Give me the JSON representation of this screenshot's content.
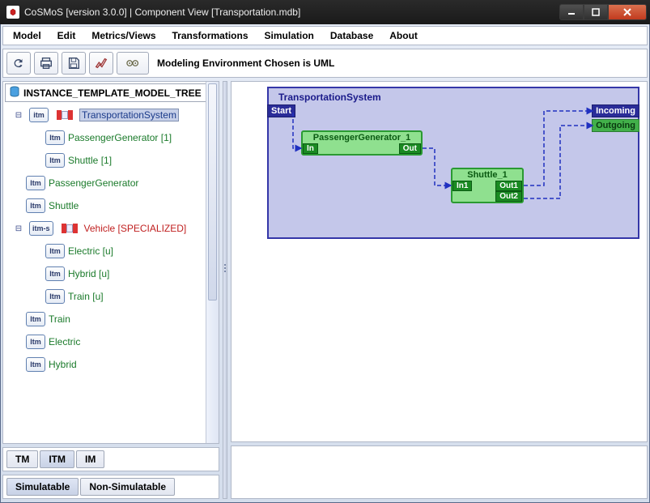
{
  "window": {
    "title": "CoSMoS [version 3.0.0] | Component View [Transportation.mdb]"
  },
  "menu": {
    "items": [
      "Model",
      "Edit",
      "Metrics/Views",
      "Transformations",
      "Simulation",
      "Database",
      "About"
    ]
  },
  "toolbar": {
    "icons": [
      "refresh-icon",
      "print-icon",
      "save-icon",
      "chart-icon",
      "gears-icon"
    ],
    "status": "Modeling Environment Chosen is UML"
  },
  "tree": {
    "header": "INSTANCE_TEMPLATE_MODEL_TREE",
    "nodes": [
      {
        "indent": 0,
        "toggle": "▾",
        "icon": "comp",
        "label": "TransportationSystem",
        "selected": true
      },
      {
        "indent": 1,
        "toggle": "",
        "icon": "Itm",
        "label": "PassengerGenerator [1]"
      },
      {
        "indent": 1,
        "toggle": "",
        "icon": "Itm",
        "label": "Shuttle [1]"
      },
      {
        "indent": 0,
        "toggle": "",
        "icon": "Itm",
        "label": "PassengerGenerator"
      },
      {
        "indent": 0,
        "toggle": "",
        "icon": "Itm",
        "label": "Shuttle"
      },
      {
        "indent": 0,
        "toggle": "▾",
        "icon": "comp",
        "iconText": "itm-s",
        "label": "Vehicle [SPECIALIZED]",
        "red": true
      },
      {
        "indent": 1,
        "toggle": "",
        "icon": "Itm",
        "label": "Electric [u]"
      },
      {
        "indent": 1,
        "toggle": "",
        "icon": "Itm",
        "label": "Hybrid [u]"
      },
      {
        "indent": 1,
        "toggle": "",
        "icon": "Itm",
        "label": "Train [u]"
      },
      {
        "indent": 0,
        "toggle": "",
        "icon": "Itm",
        "label": "Train"
      },
      {
        "indent": 0,
        "toggle": "",
        "icon": "Itm",
        "label": "Electric"
      },
      {
        "indent": 0,
        "toggle": "",
        "icon": "Itm",
        "label": "Hybrid"
      }
    ]
  },
  "bottom_tabs_1": {
    "items": [
      "TM",
      "ITM",
      "IM"
    ],
    "active": 1
  },
  "bottom_tabs_2": {
    "items": [
      "Simulatable",
      "Non-Simulatable"
    ],
    "active": 0
  },
  "diagram": {
    "title": "TransportationSystem",
    "start": "Start",
    "incoming": "Incoming",
    "outgoing": "Outgoing",
    "components": [
      {
        "name": "PassengerGenerator_1",
        "in": "In",
        "out": "Out"
      },
      {
        "name": "Shuttle_1",
        "in": "In1",
        "outs": [
          "Out1",
          "Out2"
        ]
      }
    ]
  }
}
